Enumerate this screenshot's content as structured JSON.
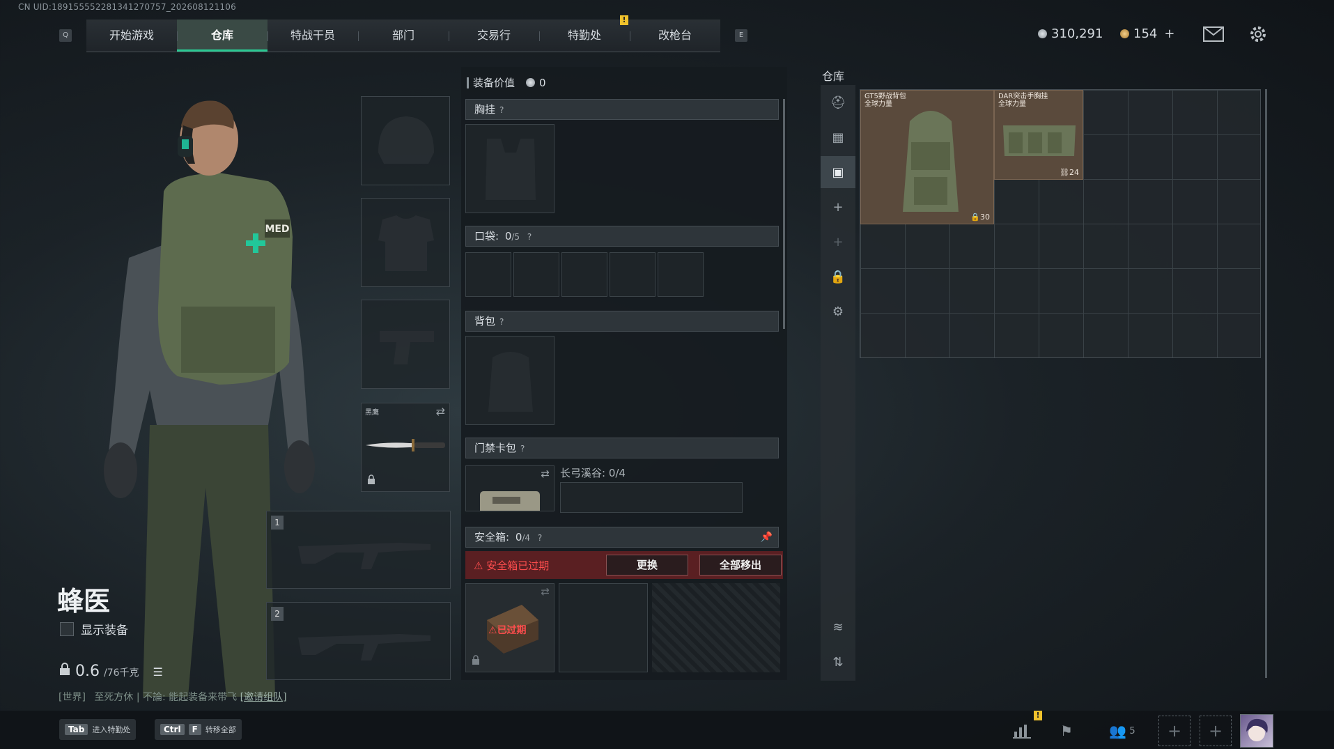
{
  "uid": "CN UID:18915555228134127075­7_202608121106",
  "nav": {
    "key_left": "Q",
    "key_right": "E",
    "tabs": [
      "开始游戏",
      "仓库",
      "特战干员",
      "部门",
      "交易行",
      "特勤处",
      "改枪台"
    ],
    "active_tab": "仓库",
    "badge": "!"
  },
  "currency": {
    "silver": "310,291",
    "gold": "154",
    "plus": "+"
  },
  "character": {
    "name": "蜂医",
    "show_equipment": "显示装备",
    "weight_value": "0.6",
    "weight_max": "/76千克",
    "backpack_patch": "MED"
  },
  "chat": {
    "channel": "[世界]",
    "text": "至死方休 | 不論: 能起装备来带飞",
    "link": "[邀请组队]"
  },
  "gear": {
    "melee_label": "黑鹰",
    "weapon_slot_1": "1",
    "weapon_slot_2": "2"
  },
  "equipment": {
    "value_label": "装备价值",
    "value": "0",
    "chest_rig": "胸挂",
    "pockets": "口袋:",
    "pockets_count": "0",
    "pockets_max": "/5",
    "backpack": "背包",
    "keycard": "门禁卡包",
    "keycard_map": "长弓溪谷: 0/4",
    "safebox": "安全箱:",
    "safebox_count": "0",
    "safebox_max": "/4",
    "safebox_expired": "安全箱已过期",
    "replace": "更换",
    "move_all": "全部移出",
    "expired_tag": "已过期",
    "qmark": "?"
  },
  "warehouse": {
    "title": "仓库",
    "items": [
      {
        "name": "GT5野战背包",
        "subtitle": "全球力量",
        "count": "30"
      },
      {
        "name": "DAR突击手胸挂",
        "subtitle": "全球力量",
        "count": "24"
      }
    ]
  },
  "bottom": {
    "tab_key": "Tab",
    "tab_label": "进入特勤处",
    "ctrl_key": "Ctrl",
    "f_key": "F",
    "transfer_label": "转移全部",
    "friends_count": "5",
    "badge": "!"
  }
}
